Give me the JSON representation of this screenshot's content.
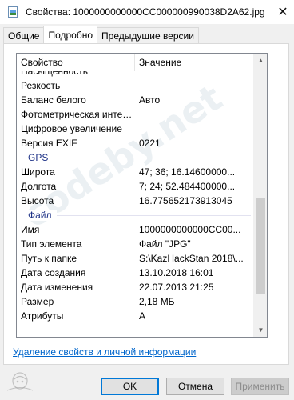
{
  "window": {
    "title": "Свойства: 1000000000000CC000000990038D2A62.jpg",
    "close_glyph": "✕",
    "icon": "image-file-icon"
  },
  "tabs": [
    {
      "label": "Общие",
      "active": false
    },
    {
      "label": "Подробно",
      "active": true
    },
    {
      "label": "Предыдущие версии",
      "active": false
    }
  ],
  "list": {
    "header": {
      "property": "Свойство",
      "value": "Значение"
    },
    "rows_top": [
      {
        "key": "Насыщенность",
        "value": ""
      },
      {
        "key": "Резкость",
        "value": ""
      },
      {
        "key": "Баланс белого",
        "value": "Авто"
      },
      {
        "key": "Фотометрическая интер...",
        "value": ""
      },
      {
        "key": "Цифровое увеличение",
        "value": ""
      },
      {
        "key": "Версия EXIF",
        "value": "0221"
      }
    ],
    "group_gps": "GPS",
    "rows_gps": [
      {
        "key": "Широта",
        "value": "47; 36; 16.14600000..."
      },
      {
        "key": "Долгота",
        "value": "7; 24; 52.484400000..."
      },
      {
        "key": "Высота",
        "value": "16.775652173913045"
      }
    ],
    "group_file": "Файл",
    "rows_file": [
      {
        "key": "Имя",
        "value": "1000000000000CC00..."
      },
      {
        "key": "Тип элемента",
        "value": "Файл \"JPG\""
      },
      {
        "key": "Путь к папке",
        "value": "S:\\KazHackStan 2018\\..."
      },
      {
        "key": "Дата создания",
        "value": "13.10.2018 16:01"
      },
      {
        "key": "Дата изменения",
        "value": "22.07.2013 21:25"
      },
      {
        "key": "Размер",
        "value": "2,18 МБ"
      },
      {
        "key": "Атрибуты",
        "value": "A"
      }
    ],
    "scroll_position": 0.82
  },
  "remove_link": "Удаление свойств и личной информации",
  "buttons": {
    "ok": "OK",
    "cancel": "Отмена",
    "apply": "Применить"
  },
  "watermark": "codeby.net",
  "colors": {
    "accent": "#0078d7",
    "link": "#0066cc",
    "group": "#1e3287"
  }
}
